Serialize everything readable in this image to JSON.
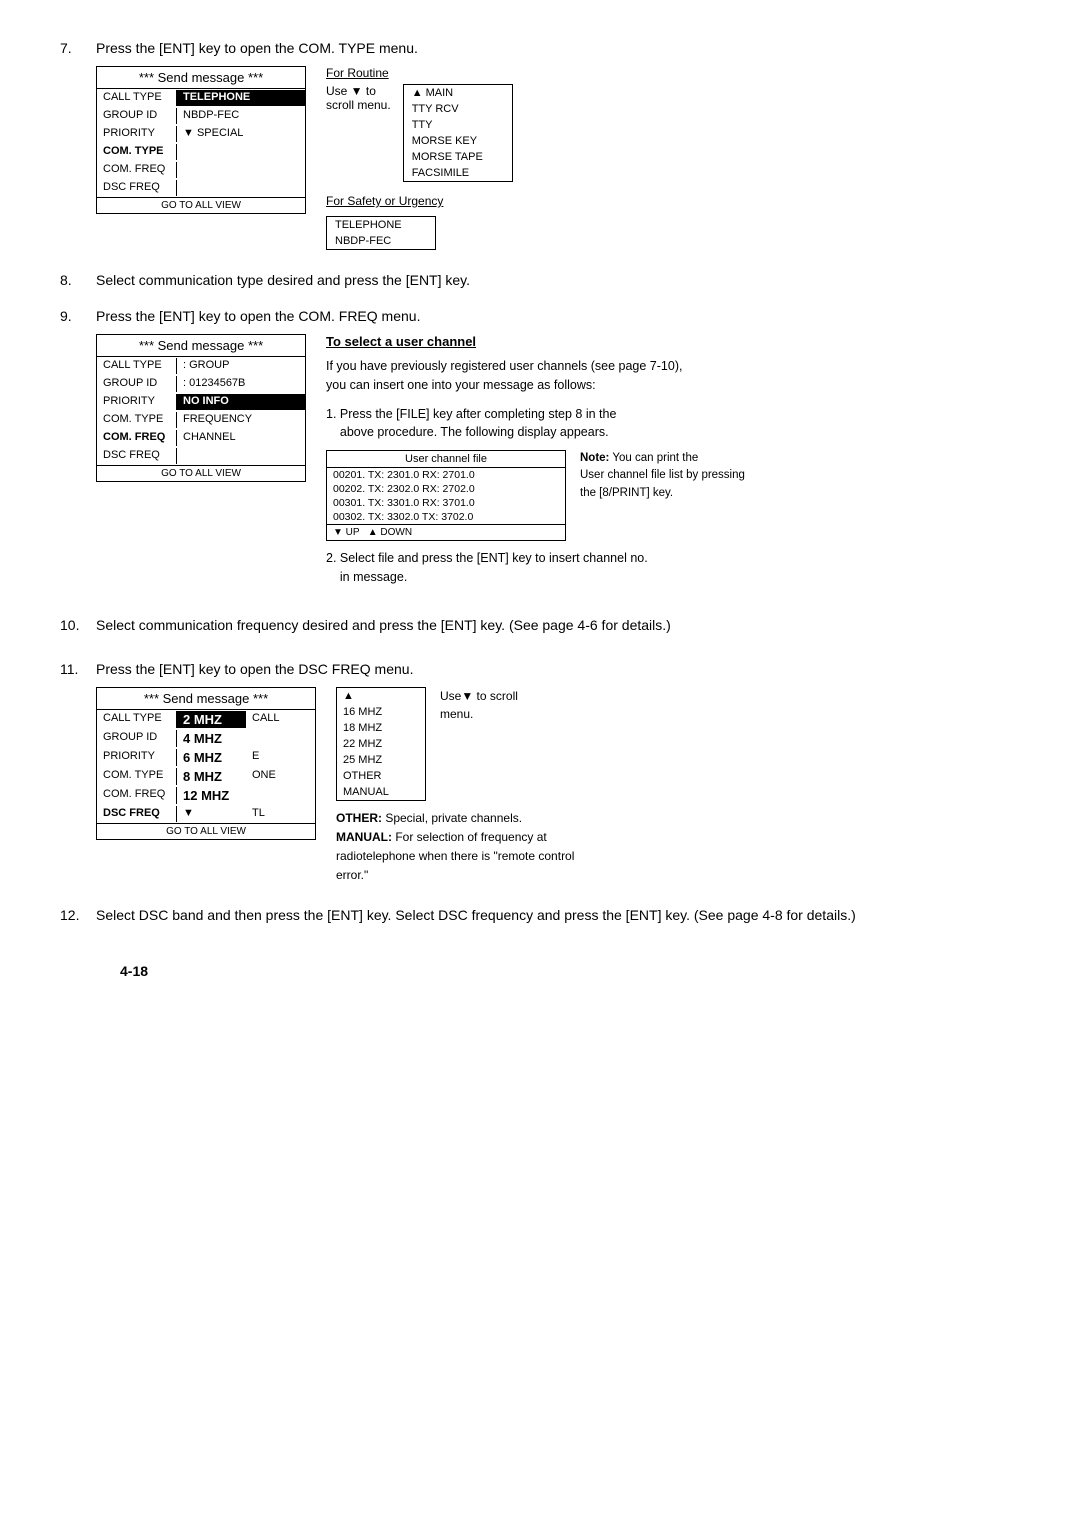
{
  "page": {
    "page_number": "4-18"
  },
  "step7": {
    "text": "Press the [ENT] key to open the COM. TYPE menu.",
    "panel": {
      "title": "*** Send message ***",
      "rows": [
        {
          "label": "CALL TYPE",
          "value": "TELEPHONE",
          "label_bold": false,
          "value_invert": true
        },
        {
          "label": "GROUP ID",
          "value": "NBDP-FEC",
          "label_bold": false,
          "value_invert": false
        },
        {
          "label": "PRIORITY",
          "value": "▼ SPECIAL",
          "label_bold": false,
          "value_invert": false
        },
        {
          "label": "COM. TYPE",
          "value": "",
          "label_bold": true,
          "value_invert": false
        },
        {
          "label": "COM. FREQ",
          "value": "",
          "label_bold": false,
          "value_invert": false
        },
        {
          "label": "DSC FREQ",
          "value": "",
          "label_bold": false,
          "value_invert": false
        }
      ],
      "footer": "GO TO ALL VIEW"
    },
    "for_routine": {
      "label": "For Routine",
      "use_text": "Use ▼  to\nscroll menu.",
      "menu_items": [
        {
          "text": "▲ MAIN",
          "bold": false
        },
        {
          "text": "TTY RCV",
          "bold": false
        },
        {
          "text": "TTY",
          "bold": false
        },
        {
          "text": "MORSE KEY",
          "bold": false
        },
        {
          "text": "MORSE TAPE",
          "bold": false
        },
        {
          "text": "FACSIMILE",
          "bold": false
        }
      ]
    },
    "for_safety": {
      "label": "For Safety or Urgency",
      "menu_items": [
        {
          "text": "TELEPHONE",
          "bold": false
        },
        {
          "text": "NBDP-FEC",
          "bold": false
        }
      ]
    }
  },
  "step8": {
    "text": "Select communication type desired and press the [ENT] key."
  },
  "step9": {
    "text": "Press the [ENT] key to open the COM. FREQ menu.",
    "panel": {
      "title": "*** Send message ***",
      "rows": [
        {
          "label": "CALL TYPE",
          "value": ": GROUP",
          "label_bold": false,
          "value_invert": false
        },
        {
          "label": "GROUP ID",
          "value": ": 01234567B",
          "label_bold": false,
          "value_invert": false
        },
        {
          "label": "PRIORITY",
          "value": "NO INFO",
          "label_bold": false,
          "value_invert": true
        },
        {
          "label": "COM. TYPE",
          "value": "FREQUENCY",
          "label_bold": false,
          "value_invert": false
        },
        {
          "label": "COM. FREQ",
          "value": "CHANNEL",
          "label_bold": true,
          "value_invert": false
        },
        {
          "label": "DSC FREQ",
          "value": "",
          "label_bold": false,
          "value_invert": false
        }
      ],
      "footer": "GO TO ALL VIEW"
    },
    "user_channel": {
      "title": "To select a user channel",
      "desc": "If you have previously registered user channels (see page 7-10),\nyou can insert one into your message as follows:",
      "sub_steps": [
        {
          "num": "1.",
          "text": "Press the [FILE] key after completing step 8 in the\nabove procedure. The following display appears."
        },
        {
          "num": "2.",
          "text": "Select file and press the [ENT] key to insert channel no.\nin message."
        }
      ],
      "ucf_table": {
        "title": "User channel file",
        "rows": [
          "00201. TX: 2301.0 RX: 2701.0",
          "00202. TX: 2302.0 RX: 2702.0",
          "00301. TX: 3301.0 RX: 3701.0",
          "00302. TX: 3302.0 TX: 3702.0"
        ],
        "nav": "▼ UP  ▲ DOWN"
      },
      "note": "Note: You can print the User channel file list by pressing the [8/PRINT] key."
    }
  },
  "step10": {
    "text": "Select communication frequency desired and press the [ENT] key. (See page 4-6 for details.)"
  },
  "step11": {
    "text": "Press the [ENT] key to open the DSC FREQ menu.",
    "panel": {
      "title": "*** Send message ***",
      "rows": [
        {
          "label": "CALL TYPE",
          "value": "2 MHZ",
          "extra_val": "CALL",
          "label_bold": false,
          "value_invert": true
        },
        {
          "label": "GROUP ID",
          "value": "4 MHZ",
          "label_bold": false,
          "value_invert": false
        },
        {
          "label": "PRIORITY",
          "value": "6 MHZ",
          "extra_val": "E",
          "label_bold": false,
          "value_invert": false
        },
        {
          "label": "COM. TYPE",
          "value": "8 MHZ",
          "extra_val": "ONE",
          "label_bold": false,
          "value_invert": false
        },
        {
          "label": "COM. FREQ",
          "value": "12 MHZ",
          "label_bold": false,
          "value_invert": false
        },
        {
          "label": "DSC FREQ",
          "value": "▼",
          "extra_val": "TL",
          "label_bold": true,
          "value_invert": false
        }
      ],
      "footer": "GO TO ALL VIEW"
    },
    "freq_side": {
      "use_text": "Use▼ to scroll\nmenu.",
      "freq_list": [
        "▲",
        "16 MHZ",
        "18 MHZ",
        "22 MHZ",
        "25 MHZ",
        "OTHER",
        "MANUAL"
      ],
      "other_text": "OTHER: Special, private channels.",
      "manual_text": "MANUAL: For selection of frequency at radiotelephone when there is \"remote control error.\""
    }
  },
  "step12": {
    "text": "Select DSC band and then press the [ENT] key. Select DSC frequency and press the [ENT] key. (See page 4-8 for details.)"
  }
}
